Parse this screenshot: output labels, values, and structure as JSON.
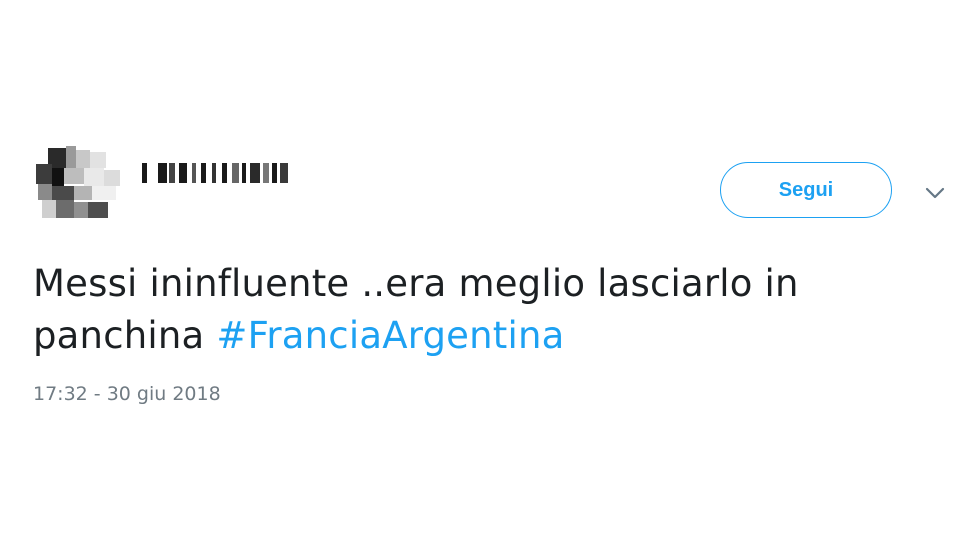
{
  "tweet": {
    "follow_label": "Segui",
    "menu_icon": "chevron-down-icon",
    "text_line1": "Messi ininfluente ..era meglio lasciarlo in",
    "text_line2": "panchina ",
    "hashtag": "#FranciaArgentina",
    "timestamp": "17:32 - 30 giu 2018"
  },
  "colors": {
    "accent": "#1da1f2",
    "text": "#1c2023",
    "muted": "#707b83"
  }
}
